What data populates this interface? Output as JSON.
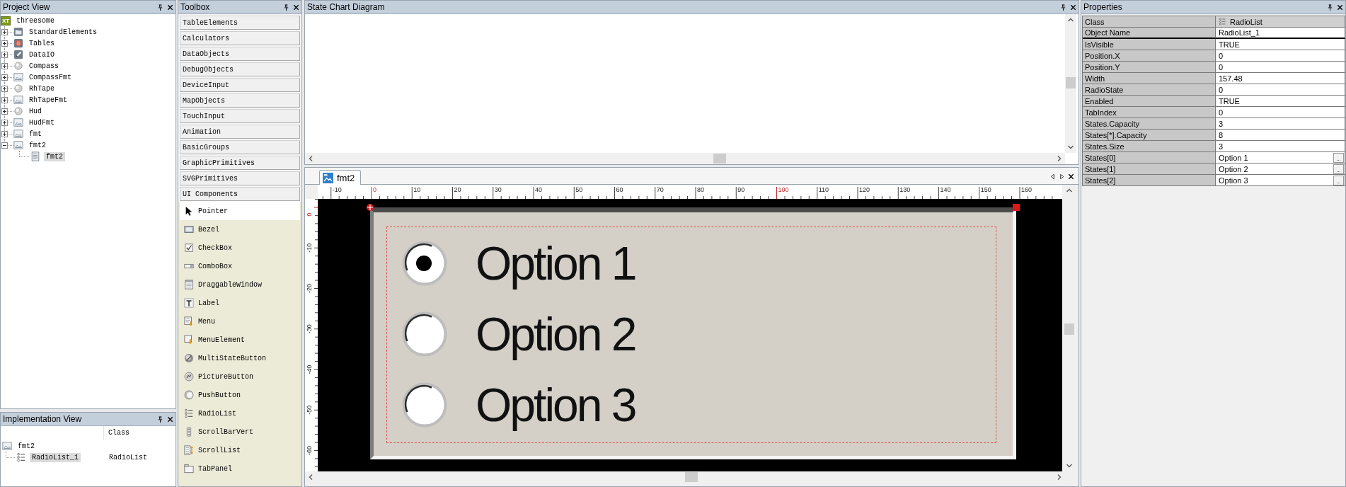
{
  "project_view": {
    "title": "Project View",
    "tree": [
      {
        "label": "threesome",
        "badge": "XT",
        "kind": "project",
        "selected": false,
        "children": [
          {
            "label": "StandardElements",
            "kind": "folder",
            "expanded": false,
            "selected": false
          },
          {
            "label": "Tables",
            "kind": "table",
            "expanded": false,
            "selected": false
          },
          {
            "label": "DataIO",
            "kind": "io",
            "expanded": false,
            "selected": false
          },
          {
            "label": "Compass",
            "kind": "object",
            "expanded": false,
            "selected": false
          },
          {
            "label": "CompassFmt",
            "kind": "format",
            "expanded": false,
            "selected": false
          },
          {
            "label": "RhTape",
            "kind": "object",
            "expanded": false,
            "selected": false
          },
          {
            "label": "RhTapeFmt",
            "kind": "format",
            "expanded": false,
            "selected": false
          },
          {
            "label": "Hud",
            "kind": "object",
            "expanded": false,
            "selected": false
          },
          {
            "label": "HudFmt",
            "kind": "format",
            "expanded": false,
            "selected": false
          },
          {
            "label": "fmt",
            "kind": "format",
            "expanded": false,
            "selected": false
          },
          {
            "label": "fmt2",
            "kind": "format",
            "expanded": true,
            "selected": false,
            "children": [
              {
                "label": "fmt2",
                "kind": "page",
                "selected": true
              }
            ]
          }
        ]
      }
    ]
  },
  "implementation_view": {
    "title": "Implementation View",
    "class_header": "Class",
    "tree": [
      {
        "label": "fmt2",
        "kind": "format",
        "selected": false,
        "children": [
          {
            "label": "RadioList_1",
            "kind": "radio-list",
            "class": "RadioList",
            "selected": true
          }
        ]
      }
    ]
  },
  "toolbox": {
    "title": "Toolbox",
    "categories": [
      {
        "label": "TableElements"
      },
      {
        "label": "Calculators"
      },
      {
        "label": "DataObjects"
      },
      {
        "label": "DebugObjects"
      },
      {
        "label": "DeviceInput"
      },
      {
        "label": "MapObjects"
      },
      {
        "label": "TouchInput"
      },
      {
        "label": "Animation"
      },
      {
        "label": "BasicGroups"
      },
      {
        "label": "GraphicPrimitives"
      },
      {
        "label": "SVGPrimitives"
      },
      {
        "label": "UI Components",
        "items": [
          {
            "label": "Pointer",
            "kind": "pointer",
            "selected": true
          },
          {
            "label": "Bezel",
            "kind": "bezel",
            "selected": false
          },
          {
            "label": "CheckBox",
            "kind": "checkbox",
            "selected": false
          },
          {
            "label": "ComboBox",
            "kind": "combobox",
            "selected": false
          },
          {
            "label": "DraggableWindow",
            "kind": "window",
            "selected": false
          },
          {
            "label": "Label",
            "kind": "label",
            "selected": false
          },
          {
            "label": "Menu",
            "kind": "menu",
            "selected": false
          },
          {
            "label": "MenuElement",
            "kind": "menu-element",
            "selected": false
          },
          {
            "label": "MultiStateButton",
            "kind": "multistate",
            "selected": false
          },
          {
            "label": "PictureButton",
            "kind": "picture-button",
            "selected": false
          },
          {
            "label": "PushButton",
            "kind": "push-button",
            "selected": false
          },
          {
            "label": "RadioList",
            "kind": "radio-list",
            "selected": false
          },
          {
            "label": "ScrollBarVert",
            "kind": "scrollbar",
            "selected": false
          },
          {
            "label": "ScrollList",
            "kind": "scroll-list",
            "selected": false
          },
          {
            "label": "TabPanel",
            "kind": "tab-panel",
            "selected": false
          }
        ]
      }
    ]
  },
  "state_chart": {
    "title": "State Chart Diagram"
  },
  "editor": {
    "tabs": [
      {
        "label": "fmt2",
        "selected": true
      }
    ],
    "ruler": {
      "x_labels": [
        {
          "label": "-10",
          "marked": false
        },
        {
          "label": "0",
          "marked": true
        },
        {
          "label": "10",
          "marked": false
        },
        {
          "label": "20",
          "marked": false
        },
        {
          "label": "30",
          "marked": false
        },
        {
          "label": "40",
          "marked": false
        },
        {
          "label": "50",
          "marked": false
        },
        {
          "label": "60",
          "marked": false
        },
        {
          "label": "70",
          "marked": false
        },
        {
          "label": "80",
          "marked": false
        },
        {
          "label": "90",
          "marked": false
        },
        {
          "label": "100",
          "marked": true
        },
        {
          "label": "110",
          "marked": false
        },
        {
          "label": "120",
          "marked": false
        },
        {
          "label": "130",
          "marked": false
        },
        {
          "label": "140",
          "marked": false
        },
        {
          "label": "150",
          "marked": false
        },
        {
          "label": "160",
          "marked": false
        }
      ],
      "y_labels": [
        {
          "label": "0",
          "marked": true
        },
        {
          "label": "-10",
          "marked": false
        },
        {
          "label": "-20",
          "marked": false
        },
        {
          "label": "-30",
          "marked": false
        },
        {
          "label": "-40",
          "marked": false
        },
        {
          "label": "-50",
          "marked": false
        },
        {
          "label": "-60",
          "marked": false
        }
      ]
    },
    "radio_list": {
      "options": [
        {
          "label": "Option 1",
          "selected": true
        },
        {
          "label": "Option 2",
          "selected": false
        },
        {
          "label": "Option 3",
          "selected": false
        }
      ]
    }
  },
  "properties": {
    "title": "Properties",
    "rows": [
      {
        "name": "Class",
        "value": "RadioList",
        "kind": "class"
      },
      {
        "name": "Object Name",
        "value": "RadioList_1",
        "kind": "name"
      },
      {
        "name": "IsVisible",
        "value": "TRUE",
        "kind": "value"
      },
      {
        "name": "Position.X",
        "value": "0",
        "kind": "value"
      },
      {
        "name": "Position.Y",
        "value": "0",
        "kind": "value"
      },
      {
        "name": "Width",
        "value": "157.48",
        "kind": "value"
      },
      {
        "name": "RadioState",
        "value": "0",
        "kind": "value"
      },
      {
        "name": "Enabled",
        "value": "TRUE",
        "kind": "value"
      },
      {
        "name": "TabIndex",
        "value": "0",
        "kind": "value"
      },
      {
        "name": "States.Capacity",
        "value": "3",
        "kind": "value"
      },
      {
        "name": "States[*].Capacity",
        "value": "8",
        "kind": "value"
      },
      {
        "name": "States.Size",
        "value": "3",
        "kind": "value"
      },
      {
        "name": "States[0]",
        "value": "Option 1",
        "kind": "list",
        "button": "..."
      },
      {
        "name": "States[1]",
        "value": "Option 2",
        "kind": "list",
        "button": "..."
      },
      {
        "name": "States[2]",
        "value": "Option 3",
        "kind": "list",
        "button": "..."
      }
    ]
  }
}
